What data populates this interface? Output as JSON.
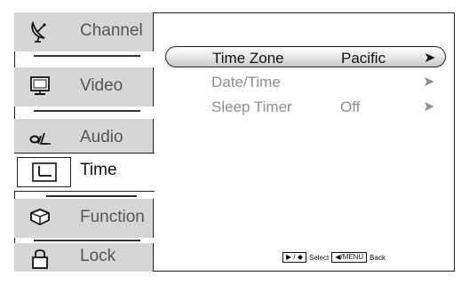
{
  "sidebar": {
    "items": [
      {
        "label": "Channel",
        "icon": "satellite-dish-icon"
      },
      {
        "label": "Video",
        "icon": "monitor-icon"
      },
      {
        "label": "Audio",
        "icon": "audio-icon"
      },
      {
        "label": "Time",
        "icon": "time-icon",
        "active": true
      },
      {
        "label": "Function",
        "icon": "function-icon"
      },
      {
        "label": "Lock",
        "icon": "lock-icon"
      }
    ]
  },
  "menu": {
    "rows": [
      {
        "name": "Time Zone",
        "value": "Pacific",
        "arrow": "➤",
        "selected": true
      },
      {
        "name": "Date/Time",
        "value": "",
        "arrow": "➤",
        "selected": false
      },
      {
        "name": "Sleep Timer",
        "value": "Off",
        "arrow": "➤",
        "selected": false
      }
    ]
  },
  "hint": {
    "nav_key": "▶ / ◆",
    "select_label": "Select",
    "back_key": "◀/MENU",
    "back_label": "Back"
  }
}
